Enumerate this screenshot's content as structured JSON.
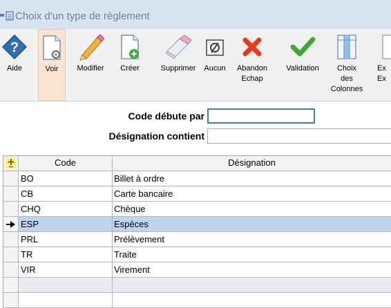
{
  "window": {
    "title": "Choix d'un type de règlement"
  },
  "toolbar": {
    "buttons": [
      {
        "label": "Aide",
        "icon": "help-icon"
      },
      {
        "label": "Voir",
        "icon": "view-document-icon",
        "active": true
      },
      {
        "label": "Modifier",
        "icon": "pencil-icon"
      },
      {
        "label": "Créer",
        "icon": "new-document-icon"
      },
      {
        "label": "Supprimer",
        "icon": "eraser-icon"
      },
      {
        "label": "Aucun",
        "icon": "none-icon"
      },
      {
        "label": "Abandon Echap",
        "icon": "cancel-icon"
      },
      {
        "label": "Validation",
        "icon": "check-icon"
      },
      {
        "label": "Choix des Colonnes",
        "icon": "columns-icon"
      },
      {
        "label": "Ex Ex",
        "icon": "export-icon"
      }
    ]
  },
  "filters": {
    "code_label": "Code débute par",
    "code_value": "",
    "designation_label": "Désignation contient",
    "designation_value": ""
  },
  "grid": {
    "columns": [
      "Code",
      "Désignation"
    ],
    "rows": [
      {
        "code": "BO",
        "designation": "Billet à ordre"
      },
      {
        "code": "CB",
        "designation": "Carte bancaire"
      },
      {
        "code": "CHQ",
        "designation": "Chèque"
      },
      {
        "code": "ESP",
        "designation": "Espèces",
        "selected": true
      },
      {
        "code": "PRL",
        "designation": "Prélèvement"
      },
      {
        "code": "TR",
        "designation": "Traite"
      },
      {
        "code": "VIR",
        "designation": "Virement"
      }
    ],
    "blank_rows": 2
  },
  "colors": {
    "title_bar": "#d7e4f2",
    "selected_row": "#bed3ed",
    "active_button": "#fbe5d2",
    "input_focus_border": "#3c7fb1"
  }
}
